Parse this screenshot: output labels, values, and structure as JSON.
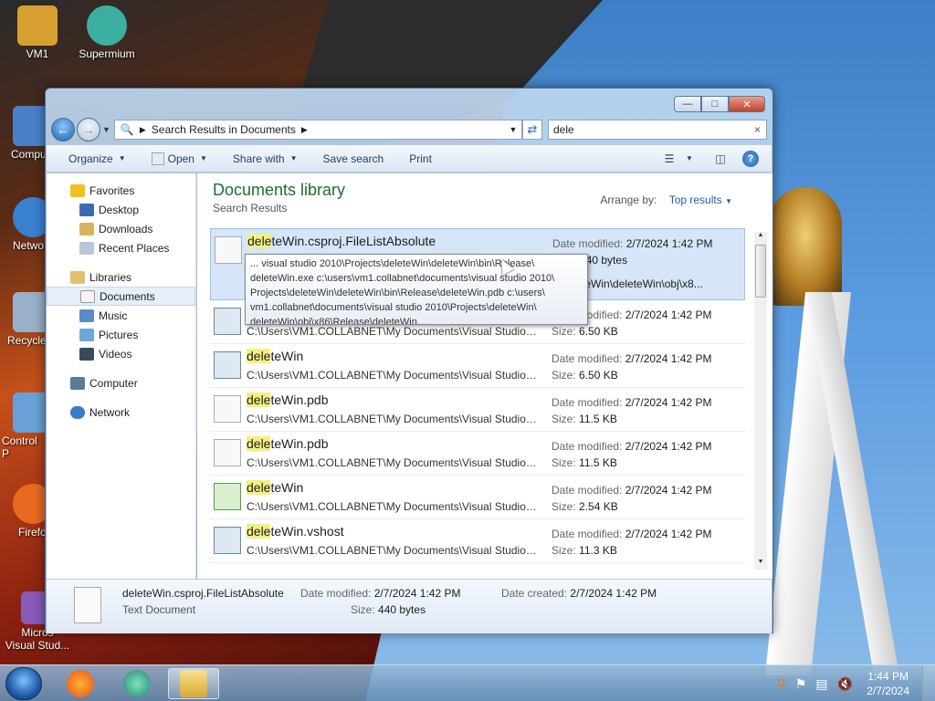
{
  "desktop": {
    "icons": [
      {
        "label": "VM1",
        "color": "#d8a030"
      },
      {
        "label": "Supermium",
        "color": "#3cb0a0"
      },
      {
        "label": "Compu",
        "color": "#4a80c8"
      },
      {
        "label": "Netwo",
        "color": "#3a80d0"
      },
      {
        "label": "Recycle",
        "color": "#9ab0c8"
      },
      {
        "label": "Control P",
        "color": "#6aa0d8"
      },
      {
        "label": "Firefo",
        "color": "#e86a20"
      },
      {
        "label": "Micros\nVisual Stud...",
        "color": "#8a5ab8"
      }
    ]
  },
  "window": {
    "caption_buttons": {
      "minimize": "—",
      "maximize": "□",
      "close": "✕"
    },
    "address": {
      "segment": "Search Results in Documents"
    },
    "search": {
      "value": "dele",
      "clear": "×"
    },
    "toolbar": {
      "organize": "Organize",
      "open": "Open",
      "share_with": "Share with",
      "save_search": "Save search",
      "print": "Print",
      "help": "?"
    },
    "nav": {
      "favorites": "Favorites",
      "desktop": "Desktop",
      "downloads": "Downloads",
      "recent": "Recent Places",
      "libraries": "Libraries",
      "documents": "Documents",
      "music": "Music",
      "pictures": "Pictures",
      "videos": "Videos",
      "computer": "Computer",
      "network": "Network"
    },
    "library": {
      "title": "Documents library",
      "subtitle": "Search Results",
      "arrange_label": "Arrange by:",
      "arrange_value": "Top results"
    },
    "labels": {
      "date_modified": "Date modified:",
      "size": "Size:",
      "date_created": "Date created:"
    },
    "files": [
      {
        "hl": "dele",
        "rest": "teWin.csproj.FileListAbsolute",
        "path": "",
        "date": "2/7/2024 1:42 PM",
        "size": "440 bytes",
        "extra": "s\\deleteWin\\deleteWin\\obj\\x8...",
        "icon": "doc"
      },
      {
        "hl": "dele",
        "rest": "teWin",
        "path": "C:\\Users\\VM1.COLLABNET\\My Documents\\Visual Studio ...",
        "date": "2/7/2024 1:42 PM",
        "size": "6.50 KB",
        "icon": "exe"
      },
      {
        "hl": "dele",
        "rest": "teWin",
        "path": "C:\\Users\\VM1.COLLABNET\\My Documents\\Visual Studio ...",
        "date": "2/7/2024 1:42 PM",
        "size": "6.50 KB",
        "icon": "exe"
      },
      {
        "hl": "dele",
        "rest": "teWin.pdb",
        "path": "C:\\Users\\VM1.COLLABNET\\My Documents\\Visual Studio ...",
        "date": "2/7/2024 1:42 PM",
        "size": "11.5 KB",
        "icon": "doc"
      },
      {
        "hl": "dele",
        "rest": "teWin.pdb",
        "path": "C:\\Users\\VM1.COLLABNET\\My Documents\\Visual Studio ...",
        "date": "2/7/2024 1:42 PM",
        "size": "11.5 KB",
        "icon": "doc"
      },
      {
        "hl": "dele",
        "rest": "teWin",
        "path": "C:\\Users\\VM1.COLLABNET\\My Documents\\Visual Studio ...",
        "date": "2/7/2024 1:42 PM",
        "size": "2.54 KB",
        "icon": "cs"
      },
      {
        "hl": "dele",
        "rest": "teWin.vshost",
        "path": "C:\\Users\\VM1.COLLABNET\\My Documents\\Visual Studio ...",
        "date": "2/7/2024 1:42 PM",
        "size": "11.3 KB",
        "icon": "exe"
      }
    ],
    "tooltip": "... visual studio 2010\\Projects\\deleteWin\\deleteWin\\bin\\Release\\\ndeleteWin.exe c:\\users\\vm1.collabnet\\documents\\visual studio 2010\\\nProjects\\deleteWin\\deleteWin\\bin\\Release\\deleteWin.pdb c:\\users\\\nvm1.collabnet\\documents\\visual studio 2010\\Projects\\deleteWin\\\ndeleteWin\\obj\\x86\\Release\\deleteWin...",
    "details": {
      "name": "deleteWin.csproj.FileListAbsolute",
      "type": "Text Document",
      "modified": "2/7/2024 1:42 PM",
      "size": "440 bytes",
      "created": "2/7/2024 1:42 PM"
    }
  },
  "taskbar": {
    "clock_time": "1:44 PM",
    "clock_date": "2/7/2024",
    "tray_icons": [
      "search-icon",
      "flag-icon",
      "network-icon",
      "volume-muted-icon"
    ]
  }
}
